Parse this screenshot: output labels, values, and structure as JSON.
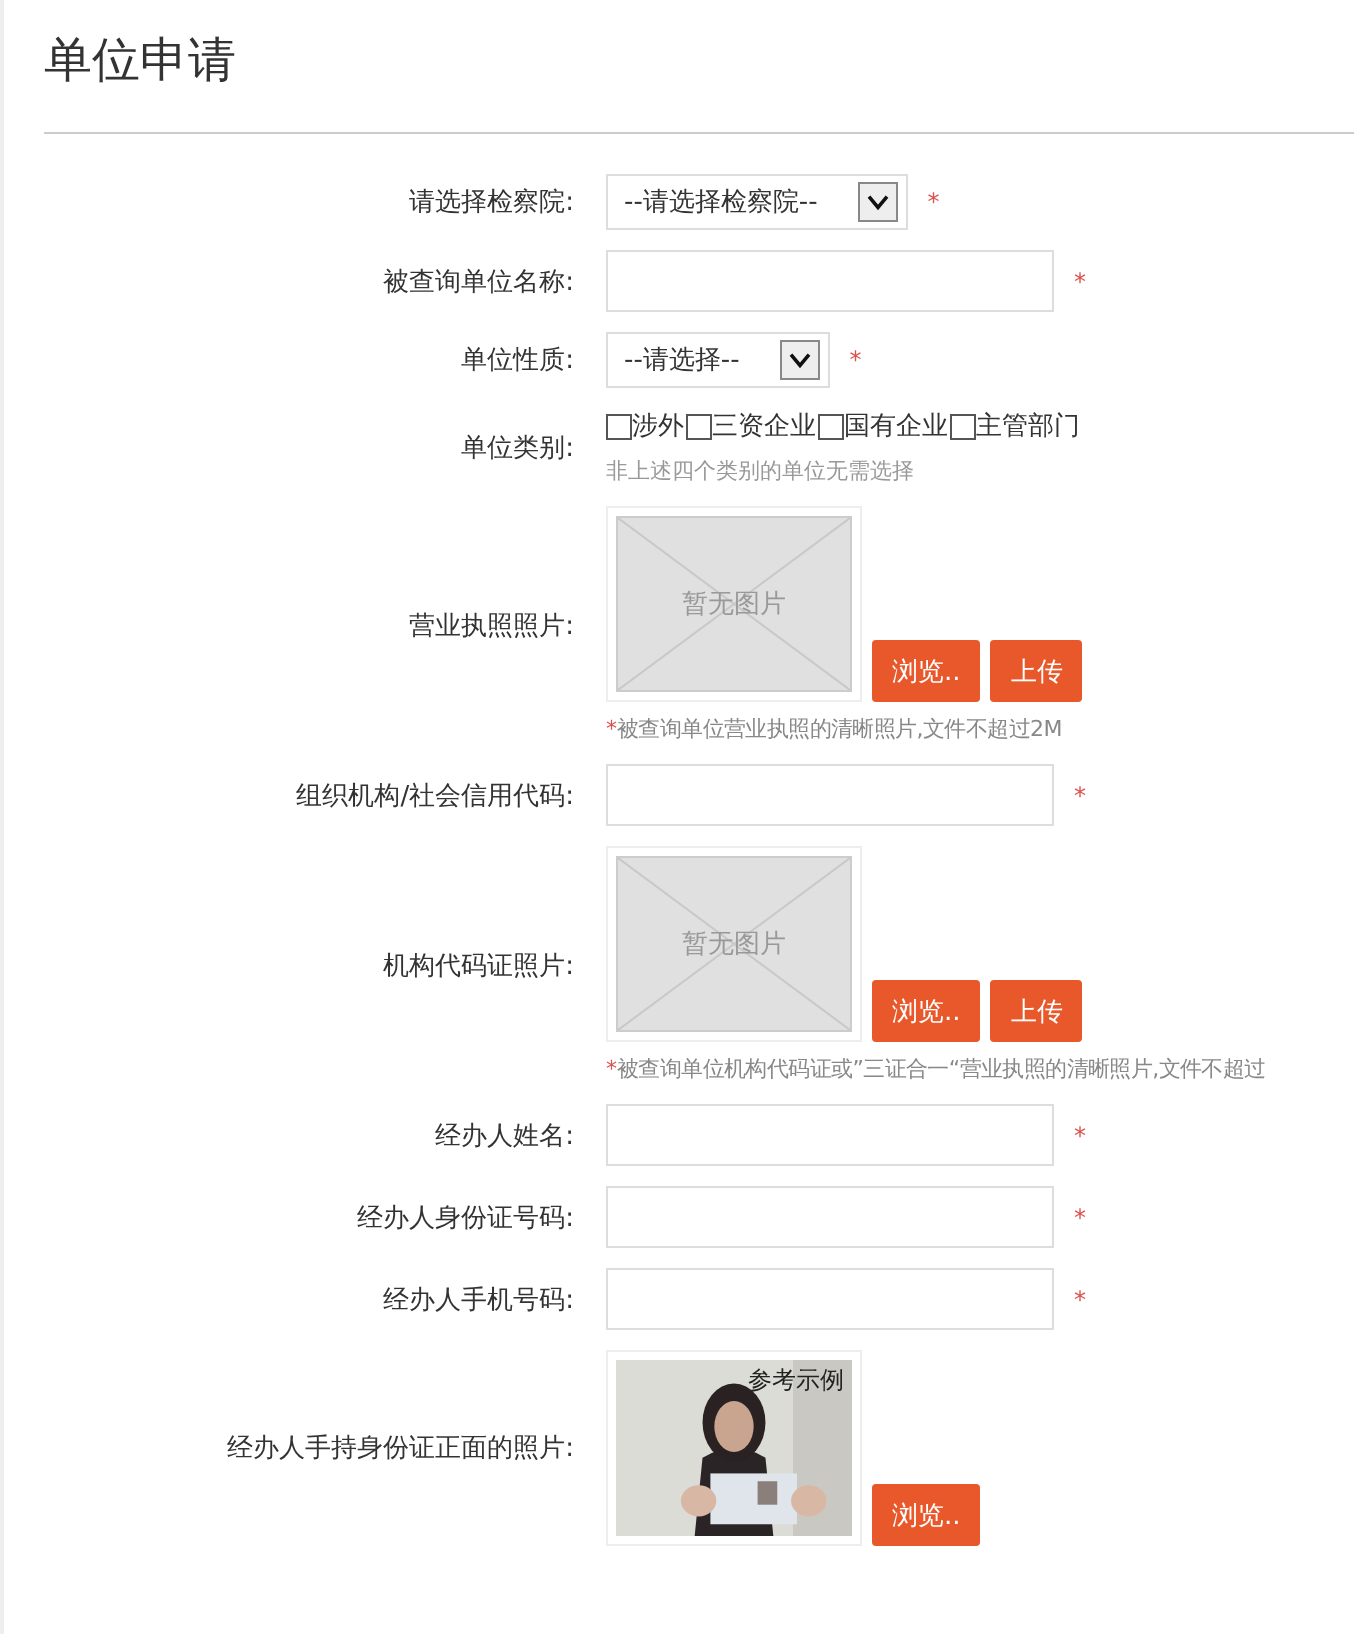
{
  "title": "单位申请",
  "fields": [
    {
      "kind": "select",
      "label": "请选择检察院:",
      "value": "--请选择检察院--",
      "required_mark": "*"
    },
    {
      "kind": "text",
      "label": "被查询单位名称:",
      "required_mark": "*"
    },
    {
      "kind": "select",
      "label": "单位性质:",
      "value": "--请选择--",
      "required_mark": "*"
    },
    {
      "kind": "checkboxes",
      "label": "单位类别:",
      "options": [
        {
          "label": "涉外",
          "checked": false
        },
        {
          "label": "三资企业",
          "checked": false
        },
        {
          "label": "国有企业",
          "checked": false
        },
        {
          "label": "主管部门",
          "checked": false
        }
      ],
      "hint": "非上述四个类别的单位无需选择"
    },
    {
      "label": "营业执照照片:",
      "placeholder": "暂无图片",
      "buttons": [
        "浏览..",
        "上传"
      ],
      "note_mark": "*",
      "note": "被查询单位营业执照的清晰照片,文件不超过2M"
    },
    {
      "kind": "text",
      "label": "组织机构/社会信用代码:",
      "required_mark": "*"
    },
    {
      "label": "机构代码证照片:",
      "placeholder": "暂无图片",
      "buttons": [
        "浏览..",
        "上传"
      ],
      "note_mark": "*",
      "note": "被查询单位机构代码证或”三证合一“营业执照的清晰照片,文件不超过"
    },
    {
      "kind": "text",
      "label": "经办人姓名:",
      "required_mark": "*"
    },
    {
      "kind": "text",
      "label": "经办人身份证号码:",
      "required_mark": "*"
    },
    {
      "kind": "text",
      "label": "经办人手机号码:",
      "required_mark": "*"
    },
    {
      "label": "经办人手持身份证正面的照片:",
      "caption": "参考示例",
      "buttons": [
        "浏览.."
      ]
    }
  ]
}
